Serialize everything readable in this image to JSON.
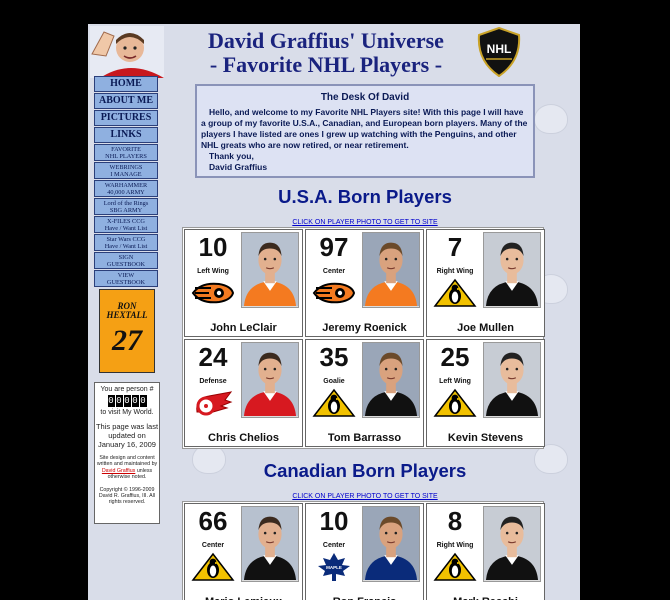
{
  "header": {
    "title_line1": "David Graffius' Universe",
    "title_line2": "- Favorite NHL Players -"
  },
  "nav": {
    "main": [
      "HOME",
      "ABOUT ME",
      "PICTURES",
      "LINKS"
    ],
    "sub": [
      [
        "FAVORITE",
        "NHL PLAYERS"
      ],
      [
        "WEBRINGS",
        "I MANAGE"
      ],
      [
        "WARHAMMER",
        "40,000 ARMY"
      ],
      [
        "Lord of the Rings",
        "SBG ARMY"
      ],
      [
        "X-FILES CCG",
        "Have / Want List"
      ],
      [
        "Star Wars CCG",
        "Have / Want List"
      ],
      [
        "SIGN",
        "GUESTBOOK"
      ],
      [
        "VIEW",
        "GUESTBOOK"
      ]
    ]
  },
  "hextall": {
    "name": "RON HEXTALL",
    "number": "27"
  },
  "counter": {
    "prefix": "You are person #",
    "digits": [
      "0",
      "0",
      "0",
      "0",
      "0"
    ],
    "suffix": "to visit My World.",
    "updated": "This page was last updated on January 16, 2009",
    "credit_pre": "Site design and content written and maintained by",
    "credit_link": "David Graffius",
    "credit_post": "unless otherwise noted.",
    "copyright": "Copyright © 1996-2009 David R. Graffius, III. All rights reserved."
  },
  "desk": {
    "title": "The Desk Of David",
    "body": "Hello, and welcome to my Favorite NHL Players site! With this page I will have a group of my favorite U.S.A., Canadian, and European born players. Many of the players I have listed are ones I grew up watching with the Penguins, and other NHL greats who are now retired, or near retirement.",
    "sign1": "Thank you,",
    "sign2": "David Graffius"
  },
  "sections": [
    {
      "title": "U.S.A. Born Players",
      "click_note": "CLICK ON PLAYER PHOTO TO GET TO SITE",
      "players": [
        {
          "number": "10",
          "position": "Left Wing",
          "name": "John LeClair",
          "team": "flyers"
        },
        {
          "number": "97",
          "position": "Center",
          "name": "Jeremy Roenick",
          "team": "flyers"
        },
        {
          "number": "7",
          "position": "Right Wing",
          "name": "Joe Mullen",
          "team": "penguins"
        },
        {
          "number": "24",
          "position": "Defense",
          "name": "Chris Chelios",
          "team": "red-wings"
        },
        {
          "number": "35",
          "position": "Goalie",
          "name": "Tom Barrasso",
          "team": "penguins"
        },
        {
          "number": "25",
          "position": "Left Wing",
          "name": "Kevin Stevens",
          "team": "penguins"
        }
      ]
    },
    {
      "title": "Canadian Born Players",
      "click_note": "CLICK ON PLAYER PHOTO TO GET TO SITE",
      "players": [
        {
          "number": "66",
          "position": "Center",
          "name": "Mario Lemieux",
          "team": "penguins"
        },
        {
          "number": "10",
          "position": "Center",
          "name": "Ron Francis",
          "team": "maple-leafs"
        },
        {
          "number": "8",
          "position": "Right Wing",
          "name": "Mark Recchi",
          "team": "penguins"
        }
      ]
    }
  ],
  "colors": {
    "title": "#1a237e",
    "nav_bg": "#8fb0e0",
    "hextall_bg": "#f5a014",
    "page_bg": "#d9dde9"
  }
}
